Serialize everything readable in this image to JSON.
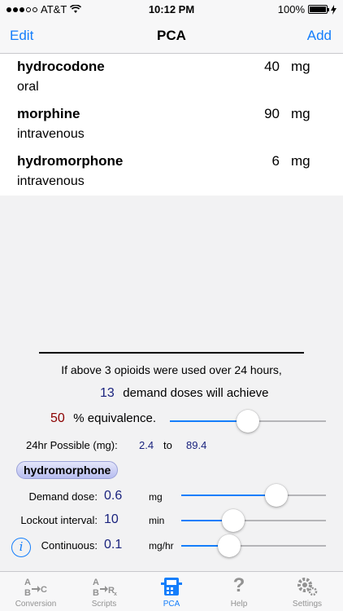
{
  "status_bar": {
    "carrier": "AT&T",
    "time": "10:12 PM",
    "battery": "100%"
  },
  "nav": {
    "edit_label": "Edit",
    "title": "PCA",
    "add_label": "Add"
  },
  "opioids": [
    {
      "name": "hydrocodone",
      "route": "oral",
      "dose": "40",
      "unit": "mg"
    },
    {
      "name": "morphine",
      "route": "intravenous",
      "dose": "90",
      "unit": "mg"
    },
    {
      "name": "hydromorphone",
      "route": "intravenous",
      "dose": "6",
      "unit": "mg"
    }
  ],
  "calc": {
    "intro": "If above 3 opioids were used over 24 hours,",
    "demand_doses": "13",
    "demand_doses_text": "demand doses will achieve",
    "equivalence_pct": "50",
    "equivalence_text": "% equivalence.",
    "equivalence_fraction": 0.5,
    "possible_label": "24hr Possible (mg):",
    "possible_low": "2.4",
    "possible_to": "to",
    "possible_high": "89.4",
    "selected_drug": "hydromorphone",
    "demand_label": "Demand dose:",
    "demand_value": "0.6",
    "demand_unit": "mg",
    "demand_fraction": 0.66,
    "lockout_label": "Lockout interval:",
    "lockout_value": "10",
    "lockout_unit": "min",
    "lockout_fraction": 0.36,
    "continuous_label": "Continuous:",
    "continuous_value": "0.1",
    "continuous_unit": "mg/hr",
    "continuous_fraction": 0.33,
    "info_glyph": "i"
  },
  "tabs": [
    {
      "label": "Conversion",
      "icon": "conversion-icon",
      "active": false
    },
    {
      "label": "Scripts",
      "icon": "scripts-icon",
      "active": false
    },
    {
      "label": "PCA",
      "icon": "pca-pump-icon",
      "active": true
    },
    {
      "label": "Help",
      "icon": "question-icon",
      "active": false
    },
    {
      "label": "Settings",
      "icon": "gear-icon",
      "active": false
    }
  ],
  "colors": {
    "accent": "#147efb",
    "dark_blue_numbers": "#1a237e",
    "dark_red_number": "#8b0000"
  }
}
